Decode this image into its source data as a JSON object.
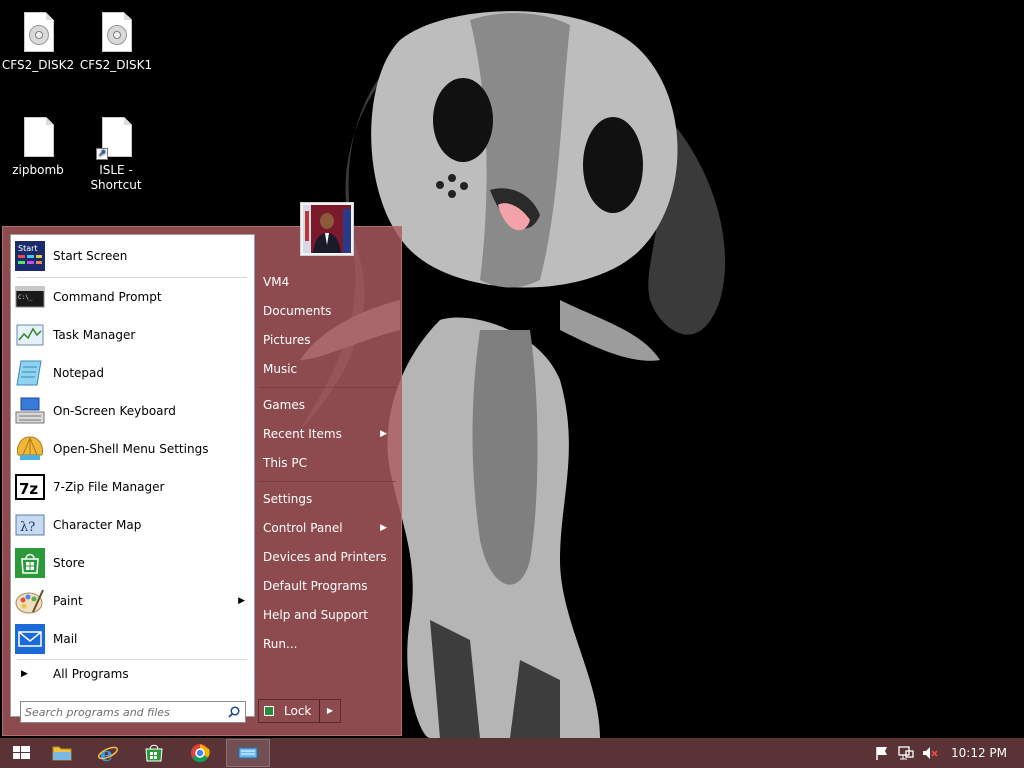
{
  "desktop": {
    "icons": [
      {
        "label": "CFS2_DISK2",
        "icon": "cd-image-icon"
      },
      {
        "label": "CFS2_DISK1",
        "icon": "cd-image-icon"
      },
      {
        "label": "zipbomb",
        "icon": "blank-file-icon"
      },
      {
        "label": "ISLE - Shortcut",
        "icon": "shortcut-file-icon"
      }
    ]
  },
  "start_menu": {
    "programs": [
      {
        "label": "Start Screen",
        "icon": "start-screen-icon"
      },
      {
        "label": "Command Prompt",
        "icon": "command-prompt-icon"
      },
      {
        "label": "Task Manager",
        "icon": "task-manager-icon"
      },
      {
        "label": "Notepad",
        "icon": "notepad-icon"
      },
      {
        "label": "On-Screen Keyboard",
        "icon": "keyboard-icon"
      },
      {
        "label": "Open-Shell Menu Settings",
        "icon": "shell-icon"
      },
      {
        "label": "7-Zip File Manager",
        "icon": "7zip-icon"
      },
      {
        "label": "Character Map",
        "icon": "character-map-icon"
      },
      {
        "label": "Store",
        "icon": "store-icon"
      },
      {
        "label": "Paint",
        "icon": "paint-icon",
        "submenu": true
      },
      {
        "label": "Mail",
        "icon": "mail-icon"
      }
    ],
    "all_programs": "All Programs",
    "search": {
      "placeholder": "Search programs and files"
    },
    "start_screen_tile_text": "Start",
    "right_items": [
      {
        "label": "VM4"
      },
      {
        "label": "Documents"
      },
      {
        "label": "Pictures"
      },
      {
        "label": "Music"
      },
      {
        "label": "Games"
      },
      {
        "label": "Recent Items",
        "submenu": true
      },
      {
        "label": "This PC"
      },
      {
        "label": "Settings"
      },
      {
        "label": "Control Panel",
        "submenu": true
      },
      {
        "label": "Devices and Printers"
      },
      {
        "label": "Default Programs"
      },
      {
        "label": "Help and Support"
      },
      {
        "label": "Run..."
      }
    ],
    "lock_label": "Lock"
  },
  "taskbar": {
    "apps": [
      "start-button-icon",
      "file-explorer-icon",
      "internet-explorer-icon",
      "store-icon",
      "chrome-icon",
      "on-screen-keyboard-icon"
    ],
    "tray": [
      "action-center-flag-icon",
      "network-icon",
      "volume-muted-icon"
    ],
    "clock": "10:12 PM"
  },
  "colors": {
    "menu_tint": "#ac5c60",
    "taskbar": "#5a3336"
  }
}
